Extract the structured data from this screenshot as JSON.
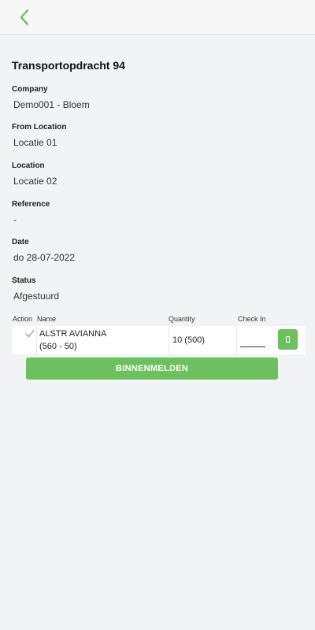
{
  "header": {
    "back_icon": "chevron-left-icon",
    "accent_color": "#6cc05d"
  },
  "page": {
    "title": "Transportopdracht 94"
  },
  "fields": {
    "company": {
      "label": "Company",
      "value": "Demo001 - Bloem"
    },
    "from_location": {
      "label": "From Location",
      "value": "Locatie 01"
    },
    "location": {
      "label": "Location",
      "value": "Locatie 02"
    },
    "reference": {
      "label": "Reference",
      "value": "-"
    },
    "date": {
      "label": "Date",
      "value": "do 28-07-2022"
    },
    "status": {
      "label": "Status",
      "value": "Afgestuurd"
    }
  },
  "table": {
    "columns": {
      "action": "Action",
      "name": "Name",
      "quantity": "Quantity",
      "check_in": "Check In"
    },
    "rows": [
      {
        "action_icon": "checkmark-icon",
        "name_line1": "ALSTR AVIANNA",
        "name_line2": "(560 - 50)",
        "quantity": "10 (500)",
        "check_in_value": ""
      }
    ]
  },
  "actions": {
    "submit_label": "BINNENMELDEN"
  }
}
